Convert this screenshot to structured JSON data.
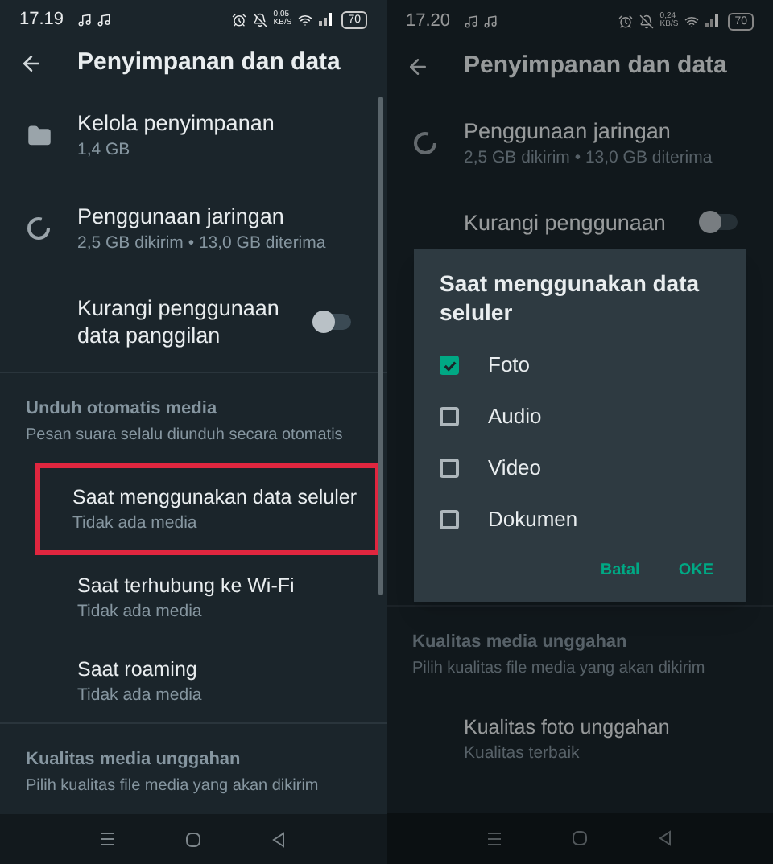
{
  "panels": [
    {
      "status_bar": {
        "time": "17.19",
        "net_speed": "0,05",
        "net_unit": "KB/S",
        "battery": "70"
      },
      "app_bar": {
        "title": "Penyimpanan dan data"
      },
      "dimmed": false,
      "items": [
        {
          "kind": "storage",
          "title": "Kelola penyimpanan",
          "subtitle": "1,4 GB"
        },
        {
          "kind": "network",
          "title": "Penggunaan jaringan",
          "subtitle": "2,5 GB dikirim • 13,0 GB diterima"
        },
        {
          "kind": "toggle",
          "title": "Kurangi penggunaan data panggilan",
          "on": false
        },
        {
          "kind": "section",
          "title": "Unduh otomatis media",
          "subtitle": "Pesan suara selalu diunduh secara otomatis"
        },
        {
          "kind": "option",
          "title": "Saat menggunakan data seluler",
          "subtitle": "Tidak ada media",
          "highlighted": true
        },
        {
          "kind": "option",
          "title": "Saat terhubung ke Wi-Fi",
          "subtitle": "Tidak ada media",
          "highlighted": false
        },
        {
          "kind": "option",
          "title": "Saat roaming",
          "subtitle": "Tidak ada media",
          "highlighted": false
        },
        {
          "kind": "section",
          "title": "Kualitas media unggahan",
          "subtitle": "Pilih kualitas file media yang akan dikirim"
        }
      ]
    },
    {
      "status_bar": {
        "time": "17.20",
        "net_speed": "0,24",
        "net_unit": "KB/S",
        "battery": "70"
      },
      "app_bar": {
        "title": "Penyimpanan dan data"
      },
      "dimmed": true,
      "items": [
        {
          "kind": "network",
          "title": "Penggunaan jaringan",
          "subtitle": "2,5 GB dikirim • 13,0 GB diterima"
        },
        {
          "kind": "toggle",
          "title": "Kurangi penggunaan",
          "on": false
        },
        {
          "kind": "spacer"
        },
        {
          "kind": "section",
          "title": "Kualitas media unggahan",
          "subtitle": "Pilih kualitas file media yang akan dikirim"
        },
        {
          "kind": "option",
          "title": "Kualitas foto unggahan",
          "subtitle": "Kualitas terbaik",
          "highlighted": false
        }
      ],
      "dialog": {
        "title": "Saat menggunakan data seluler",
        "options": [
          {
            "label": "Foto",
            "checked": true
          },
          {
            "label": "Audio",
            "checked": false
          },
          {
            "label": "Video",
            "checked": false
          },
          {
            "label": "Dokumen",
            "checked": false
          }
        ],
        "buttons": [
          "Batal",
          "OKE"
        ]
      }
    }
  ]
}
